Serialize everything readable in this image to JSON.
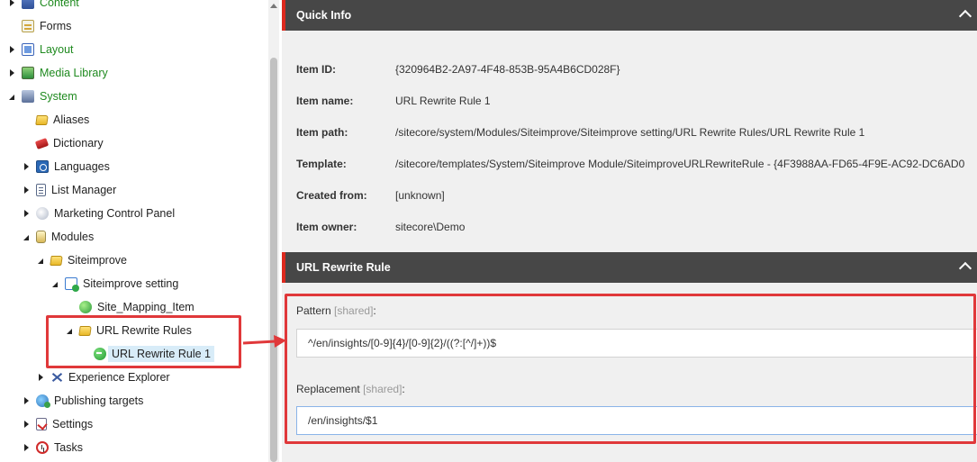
{
  "tree": {
    "items": [
      {
        "label": "Content",
        "icon": "content-icon",
        "toggle": "closed",
        "green": true
      },
      {
        "label": "Forms",
        "icon": "forms-icon",
        "toggle": "none",
        "green": false
      },
      {
        "label": "Layout",
        "icon": "layout-icon",
        "toggle": "closed",
        "green": true
      },
      {
        "label": "Media Library",
        "icon": "media-library-icon",
        "toggle": "closed",
        "green": true
      },
      {
        "label": "System",
        "icon": "system-icon",
        "toggle": "open",
        "green": true
      },
      {
        "label": "Aliases",
        "icon": "folder-icon",
        "toggle": "none",
        "green": false
      },
      {
        "label": "Dictionary",
        "icon": "dictionary-icon",
        "toggle": "none",
        "green": false
      },
      {
        "label": "Languages",
        "icon": "languages-icon",
        "toggle": "closed",
        "green": false
      },
      {
        "label": "List Manager",
        "icon": "list-manager-icon",
        "toggle": "closed",
        "green": false
      },
      {
        "label": "Marketing Control Panel",
        "icon": "marketing-icon",
        "toggle": "closed",
        "green": false
      },
      {
        "label": "Modules",
        "icon": "modules-icon",
        "toggle": "open",
        "green": false
      },
      {
        "label": "Siteimprove",
        "icon": "folder-icon",
        "toggle": "open",
        "green": false
      },
      {
        "label": "Siteimprove setting",
        "icon": "setting-item-icon",
        "toggle": "open",
        "green": false
      },
      {
        "label": "Site_Mapping_Item",
        "icon": "globe-icon",
        "toggle": "none",
        "green": false
      },
      {
        "label": "URL Rewrite Rules",
        "icon": "folder-icon",
        "toggle": "open",
        "green": false
      },
      {
        "label": "URL Rewrite Rule 1",
        "icon": "rewrite-rule-icon",
        "toggle": "none",
        "green": false,
        "selected": true
      },
      {
        "label": "Experience Explorer",
        "icon": "explorer-icon",
        "toggle": "closed",
        "green": false
      },
      {
        "label": "Publishing targets",
        "icon": "publishing-icon",
        "toggle": "closed",
        "green": false
      },
      {
        "label": "Settings",
        "icon": "settings-icon",
        "toggle": "closed",
        "green": false
      },
      {
        "label": "Tasks",
        "icon": "tasks-icon",
        "toggle": "closed",
        "green": false
      }
    ]
  },
  "quick_info": {
    "title": "Quick Info",
    "rows": [
      {
        "label": "Item ID:",
        "value": "{320964B2-2A97-4F48-853B-95A4B6CD028F}"
      },
      {
        "label": "Item name:",
        "value": "URL Rewrite Rule 1"
      },
      {
        "label": "Item path:",
        "value": "/sitecore/system/Modules/Siteimprove/Siteimprove setting/URL Rewrite Rules/URL Rewrite Rule 1"
      },
      {
        "label": "Template:",
        "value": "/sitecore/templates/System/Siteimprove Module/SiteimproveURLRewriteRule - {4F3988AA-FD65-4F9E-AC92-DC6AD0"
      },
      {
        "label": "Created from:",
        "value": "[unknown]"
      },
      {
        "label": "Item owner:",
        "value": "sitecore\\Demo"
      }
    ]
  },
  "rewrite_section": {
    "title": "URL Rewrite Rule",
    "pattern_label": "Pattern",
    "pattern_shared": "[shared]",
    "colon": ":",
    "pattern_value": "^/en/insights/[0-9]{4}/[0-9]{2}/((?:[^/]+))$",
    "replacement_label": "Replacement",
    "replacement_shared": "[shared]",
    "replacement_value": "/en/insights/$1"
  },
  "colors": {
    "header_bg": "#474747",
    "accent_red": "#dc291e",
    "highlight_red": "#e0383a",
    "tree_green": "#1f8a1f",
    "panel_bg": "#f0f0f0"
  }
}
